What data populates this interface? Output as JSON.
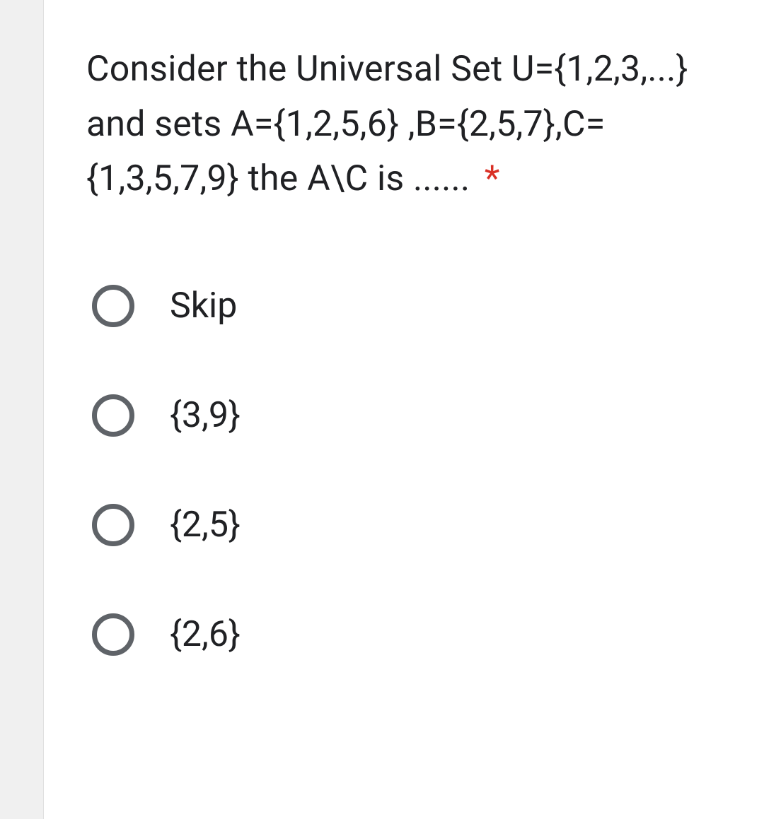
{
  "question": {
    "text": "Consider the Universal Set U={1,2,3,...} and sets A={1,2,5,6} ,B={2,5,7},C={1,3,5,7,9} the A\\C is ......",
    "required_marker": "*"
  },
  "options": [
    {
      "label": "Skip"
    },
    {
      "label": "{3,9}"
    },
    {
      "label": "{2,5}"
    },
    {
      "label": "{2,6}"
    }
  ]
}
